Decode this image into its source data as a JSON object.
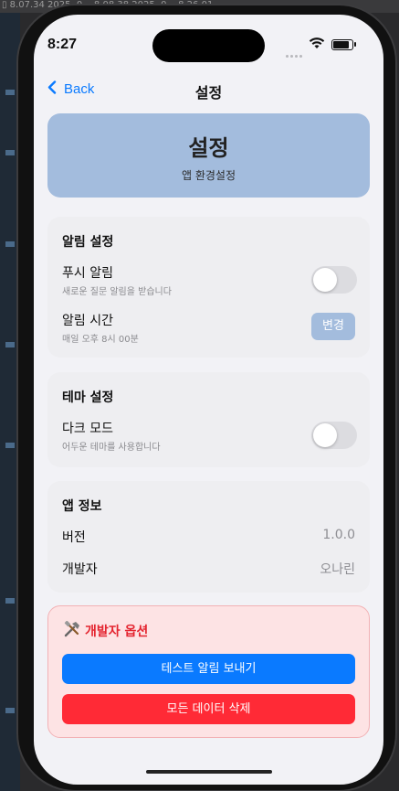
{
  "colors": {
    "accent": "#0a7aff",
    "hero": "#a3bcdd",
    "danger": "#e4242f",
    "primary_button": "#0a7aff",
    "danger_button": "#ff2a36"
  },
  "status_bar": {
    "time": "8:27",
    "wifi_icon": "wifi-icon",
    "battery_icon": "battery-icon"
  },
  "nav": {
    "back_label": "Back",
    "title": "설정"
  },
  "hero": {
    "title": "설정",
    "subtitle": "앱 환경설정"
  },
  "notifications": {
    "title": "알림 설정",
    "push": {
      "label": "푸시 알림",
      "description": "새로운 질문 알림을 받습니다",
      "enabled": false
    },
    "time": {
      "label": "알림 시간",
      "description": "매일 오후 8시 00분",
      "button": "변경"
    }
  },
  "theme": {
    "title": "테마 설정",
    "dark": {
      "label": "다크 모드",
      "description": "어두운 테마를 사용합니다",
      "enabled": false
    }
  },
  "app_info": {
    "title": "앱 정보",
    "rows": [
      {
        "label": "버전",
        "value": "1.0.0"
      },
      {
        "label": "개발자",
        "value": "오나린"
      }
    ]
  },
  "developer": {
    "icon": "tools-icon",
    "title": "개발자 옵션",
    "test_button": "테스트 알림 보내기",
    "delete_button": "모든 데이터 삭제"
  }
}
